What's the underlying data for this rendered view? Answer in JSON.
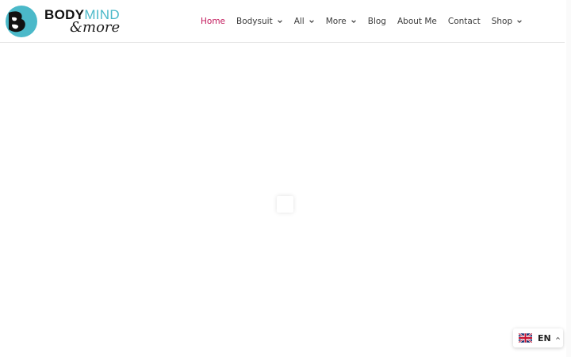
{
  "logo": {
    "word_body": "BODY",
    "word_mind": "MIND",
    "word_more": "&more"
  },
  "nav": {
    "items": [
      {
        "label": "Home",
        "active": true,
        "dropdown": false
      },
      {
        "label": "Bodysuit",
        "active": false,
        "dropdown": true
      },
      {
        "label": "All",
        "active": false,
        "dropdown": true
      },
      {
        "label": "More",
        "active": false,
        "dropdown": true
      },
      {
        "label": "Blog",
        "active": false,
        "dropdown": false
      },
      {
        "label": "About Me",
        "active": false,
        "dropdown": false
      },
      {
        "label": "Contact",
        "active": false,
        "dropdown": false
      },
      {
        "label": "Shop",
        "active": false,
        "dropdown": true
      }
    ]
  },
  "language_switcher": {
    "code": "EN",
    "flag_icon": "uk-flag-icon"
  },
  "colors": {
    "accent": "#c2185b",
    "brand_teal": "#4bb9c9"
  }
}
